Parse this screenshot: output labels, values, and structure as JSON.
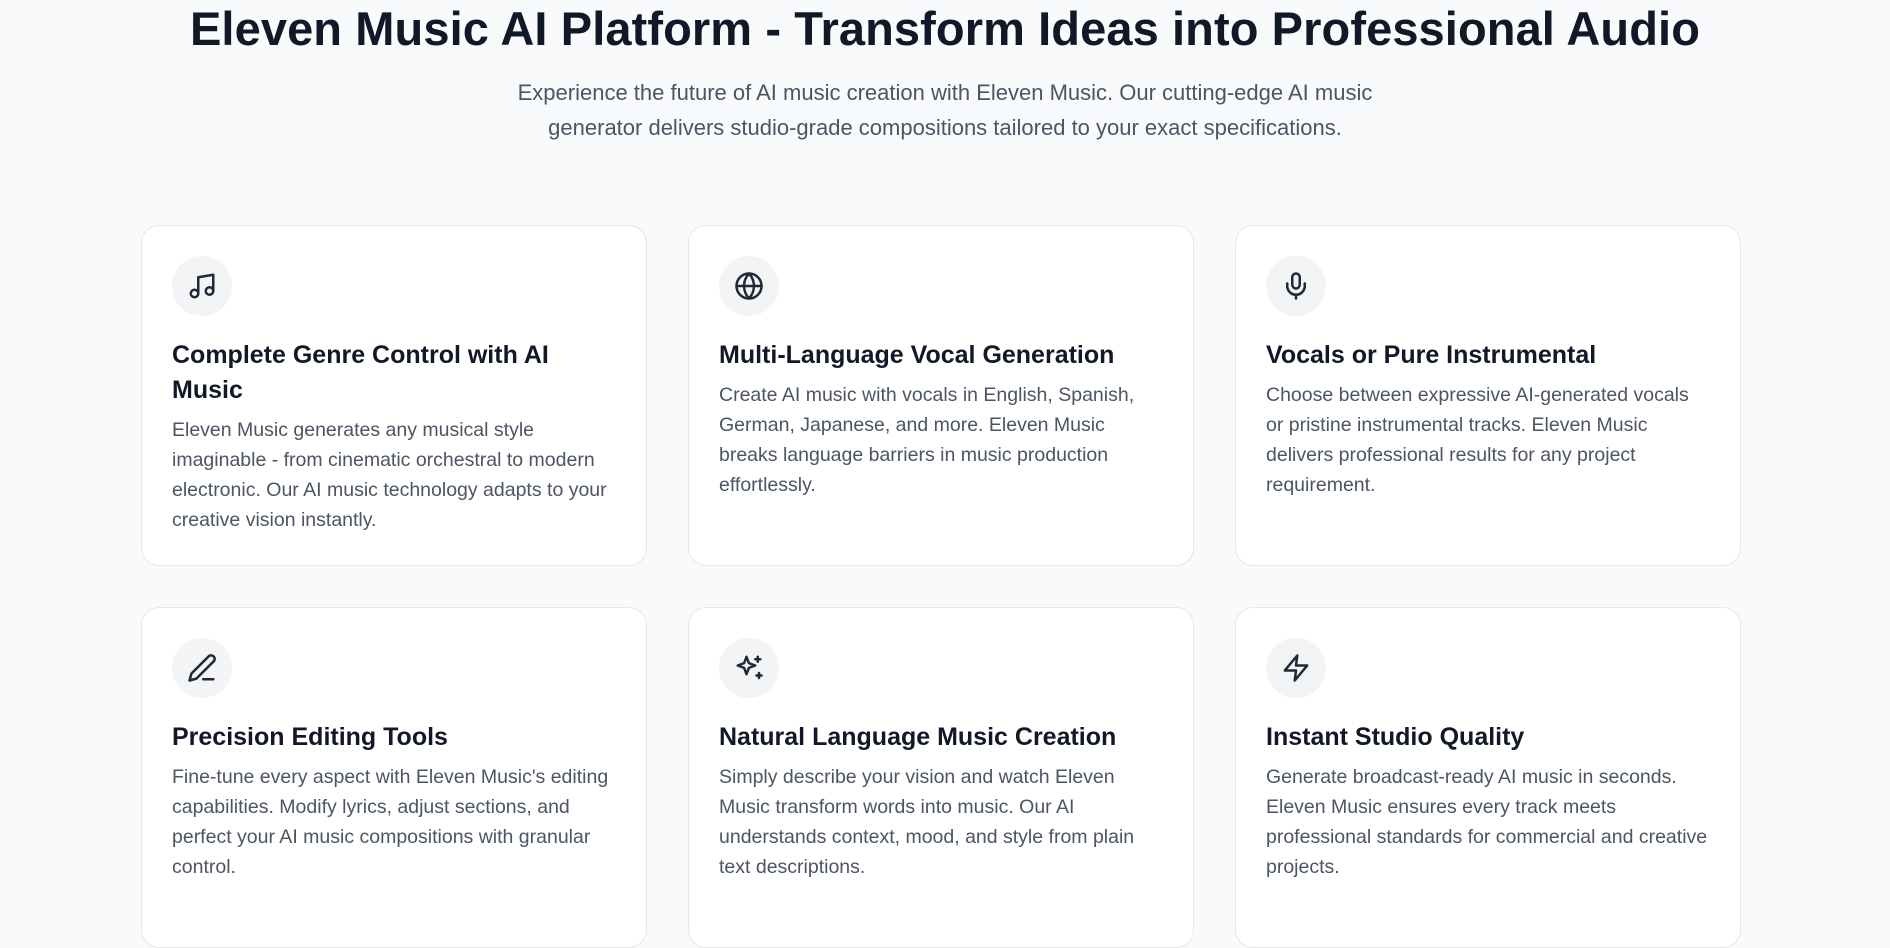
{
  "hero": {
    "title": "Eleven Music AI Platform - Transform Ideas into Professional Audio",
    "subtitle": "Experience the future of AI music creation with Eleven Music. Our cutting-edge AI music generator delivers studio-grade compositions tailored to your exact specifications."
  },
  "features": [
    {
      "icon": "music-note-icon",
      "title": "Complete Genre Control with AI Music",
      "description": "Eleven Music generates any musical style imaginable - from cinematic orchestral to modern electronic. Our AI music technology adapts to your creative vision instantly."
    },
    {
      "icon": "globe-icon",
      "title": "Multi-Language Vocal Generation",
      "description": "Create AI music with vocals in English, Spanish, German, Japanese, and more. Eleven Music breaks language barriers in music production effortlessly."
    },
    {
      "icon": "microphone-icon",
      "title": "Vocals or Pure Instrumental",
      "description": "Choose between expressive AI-generated vocals or pristine instrumental tracks. Eleven Music delivers professional results for any project requirement."
    },
    {
      "icon": "pen-icon",
      "title": "Precision Editing Tools",
      "description": "Fine-tune every aspect with Eleven Music's editing capabilities. Modify lyrics, adjust sections, and perfect your AI music compositions with granular control."
    },
    {
      "icon": "sparkles-icon",
      "title": "Natural Language Music Creation",
      "description": "Simply describe your vision and watch Eleven Music transform words into music. Our AI understands context, mood, and style from plain text descriptions."
    },
    {
      "icon": "lightning-icon",
      "title": "Instant Studio Quality",
      "description": "Generate broadcast-ready AI music in seconds. Eleven Music ensures every track meets professional standards for commercial and creative projects."
    }
  ],
  "colors": {
    "background": "#f9fafb",
    "card": "#ffffff",
    "border": "#e5e7eb",
    "icon_bg": "#f3f4f6",
    "heading": "#111827",
    "body_text": "#4b5563"
  }
}
